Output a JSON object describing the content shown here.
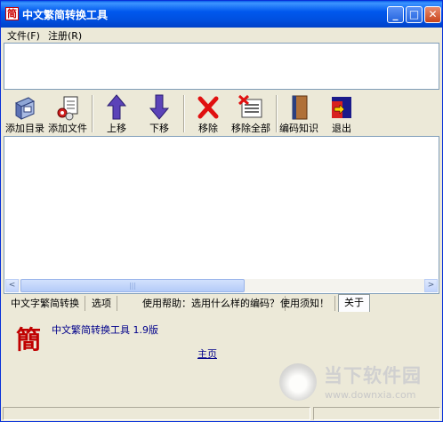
{
  "window": {
    "title": "中文繁简转换工具",
    "icon_char": "简"
  },
  "title_buttons": {
    "minimize": "_",
    "maximize": "□",
    "close": "✕"
  },
  "menu": [
    {
      "label": "文件(F)"
    },
    {
      "label": "注册(R)"
    }
  ],
  "toolbar": [
    {
      "label": "添加目录",
      "icon": "add-folder-icon"
    },
    {
      "label": "添加文件",
      "icon": "add-file-icon"
    },
    {
      "label": "上移",
      "icon": "arrow-up-icon"
    },
    {
      "label": "下移",
      "icon": "arrow-down-icon"
    },
    {
      "label": "移除",
      "icon": "remove-x-icon"
    },
    {
      "label": "移除全部",
      "icon": "remove-all-icon"
    },
    {
      "label": "编码知识",
      "icon": "book-icon"
    },
    {
      "label": "退出",
      "icon": "exit-door-icon"
    }
  ],
  "scrollbar": {
    "left": "<",
    "right": ">",
    "grip": "|||"
  },
  "tabs": [
    {
      "label": "中文字繁简转换"
    },
    {
      "label": "选项"
    },
    {
      "label": "使用帮助：选用什么样的编码？"
    },
    {
      "label": "使用须知！"
    },
    {
      "label": "关于",
      "active": true
    }
  ],
  "about": {
    "logo_char": "簡",
    "app_name": "中文繁简转换工具 1.9版",
    "home_link": "主页"
  },
  "watermark": {
    "brand": "当下软件园",
    "url": "www.downxia.com"
  },
  "colors": {
    "title_blue": "#0054e3",
    "link": "#00008b",
    "logo_red": "#c00000"
  }
}
